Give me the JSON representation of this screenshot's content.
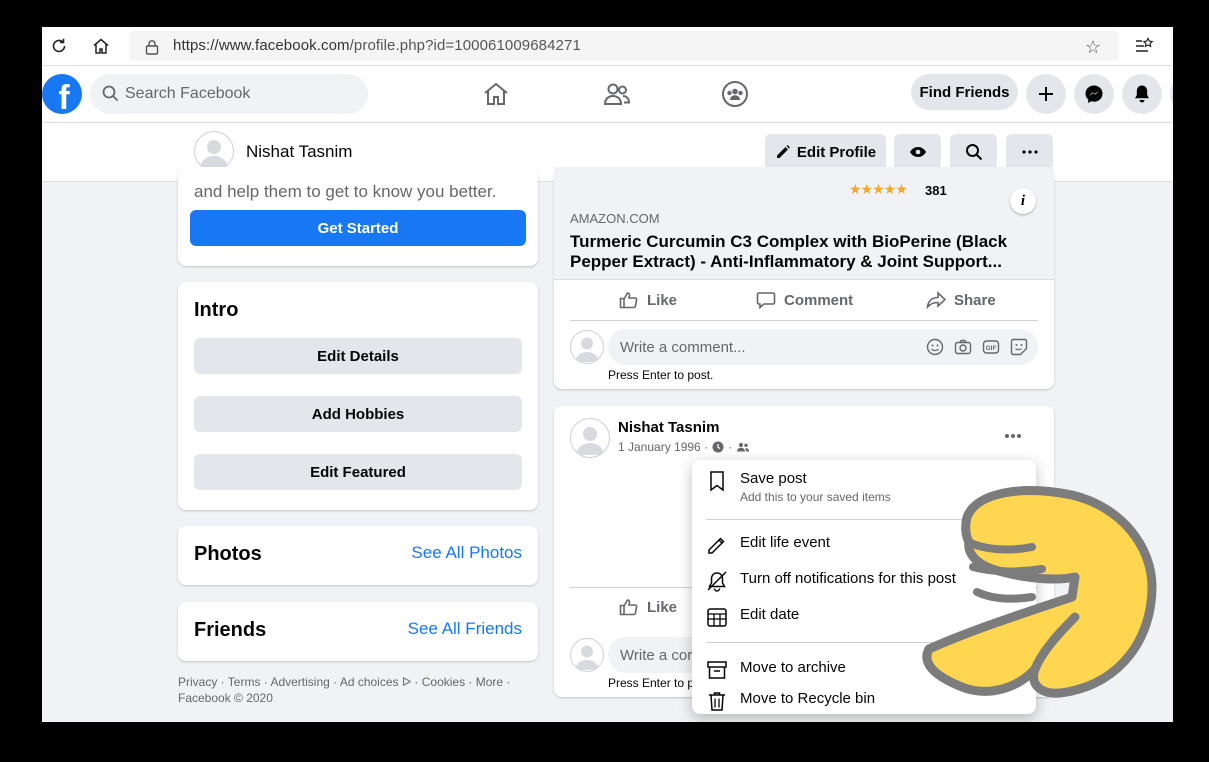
{
  "browser": {
    "url_base": "https://www.facebook.com",
    "url_rest": "/profile.php?id=100061009684271"
  },
  "topbar": {
    "search_placeholder": "Search Facebook",
    "find_friends": "Find Friends"
  },
  "profile_header": {
    "name": "Nishat Tasnim",
    "edit_profile": "Edit Profile"
  },
  "left": {
    "getstarted_text": "and help them to get to know you better.",
    "getstarted_button": "Get Started",
    "intro": {
      "title": "Intro",
      "buttons": [
        "Edit Details",
        "Add Hobbies",
        "Edit Featured"
      ]
    },
    "photos": {
      "title": "Photos",
      "see_all": "See All Photos"
    },
    "friends": {
      "title": "Friends",
      "see_all": "See All Friends"
    },
    "footer_line1": "Privacy · Terms · Advertising · Ad choices ᐅ · Cookies · More ·",
    "footer_line2": "Facebook © 2020"
  },
  "post1": {
    "rating_count": "381",
    "rating_stars": 4.5,
    "source": "AMAZON.COM",
    "title_line1": "Turmeric Curcumin C3 Complex with BioPerine (Black",
    "title_line2": "Pepper Extract) - Anti-Inflammatory & Joint Support...",
    "like": "Like",
    "comment": "Comment",
    "share": "Share",
    "comment_placeholder": "Write a comment...",
    "press_enter": "Press Enter to post."
  },
  "post2": {
    "author": "Nishat Tasnim",
    "date": "1 January 1996 ·",
    "like": "Like",
    "comment_placeholder": "Write a cor",
    "press_enter": "Press Enter to po"
  },
  "menu": {
    "save_post": "Save post",
    "save_post_sub": "Add this to your saved items",
    "edit_life_event": "Edit life event",
    "turn_off_notifications": "Turn off notifications for this post",
    "edit_date": "Edit date",
    "move_to_archive": "Move to archive",
    "move_to_recycle": "Move to Recycle bin"
  },
  "colors": {
    "fb_blue": "#1877f2",
    "page_bg": "#f0f2f5",
    "pointer_yellow": "#ffd64f"
  }
}
